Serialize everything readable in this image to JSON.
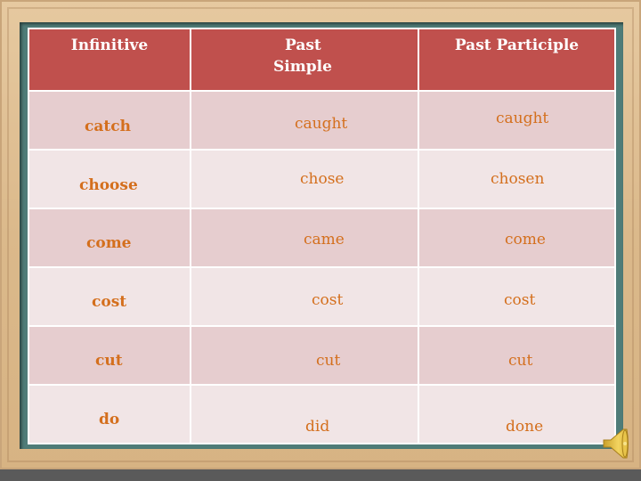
{
  "table": {
    "headers": [
      "Infinitive",
      "Past\nSimple",
      "Past Participle"
    ],
    "header_past_simple_line1": "Past",
    "header_past_simple_line2": "Simple",
    "rows": [
      {
        "infinitive": "catch",
        "past_simple": "caught",
        "past_participle": "caught"
      },
      {
        "infinitive": "choose",
        "past_simple": "chose",
        "past_participle": "chosen"
      },
      {
        "infinitive": "come",
        "past_simple": "came",
        "past_participle": "come"
      },
      {
        "infinitive": "cost",
        "past_simple": "cost",
        "past_participle": "cost"
      },
      {
        "infinitive": "cut",
        "past_simple": "cut",
        "past_participle": "cut"
      },
      {
        "infinitive": "do",
        "past_simple": "did",
        "past_participle": "done"
      }
    ]
  },
  "icons": {
    "audio": "speaker-icon"
  },
  "colors": {
    "header_bg": "#c0504d",
    "row_dark": "#e6cdcf",
    "row_light": "#f1e5e6",
    "text_orange": "#d46f1d",
    "board_green": "#4f7c78",
    "frame_wood": "#dbb98b"
  }
}
